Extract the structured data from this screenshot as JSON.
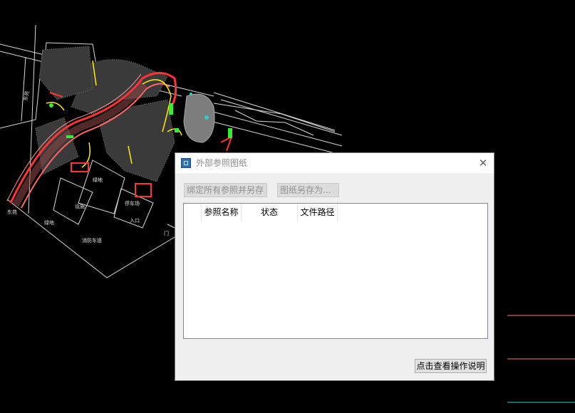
{
  "dialog": {
    "title": "外部参照图纸",
    "close_glyph": "✕",
    "toolbar": {
      "bind_all_label": "绑定所有参照并另存",
      "save_as_label": "图纸另存为..."
    },
    "table": {
      "columns": [
        "",
        "参照名称",
        "状态",
        "文件路径"
      ],
      "rows": []
    },
    "help_button_label": "点击查看操作说明"
  },
  "cad": {
    "labels": [
      "东苑",
      "东苑",
      "绿地",
      "绿地",
      "消防车道",
      "设施",
      "停车场",
      "入口",
      "门"
    ],
    "colors": {
      "background": "#000000",
      "red": "#ff3333",
      "yellow": "#ffee00",
      "green": "#33ee33",
      "white": "#ffffff",
      "cyan": "#33cccc",
      "salmon": "#ff7777",
      "gray": "#b0b0b0"
    }
  }
}
